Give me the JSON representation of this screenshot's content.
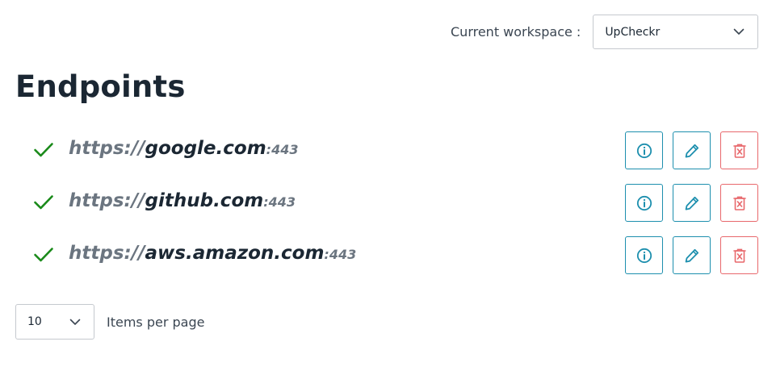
{
  "workspace": {
    "label": "Current workspace :",
    "selected": "UpCheckr",
    "icon": "chevron-down-icon"
  },
  "page": {
    "title": "Endpoints"
  },
  "endpoints": [
    {
      "protocol": "https://",
      "host": "google.com",
      "port": ":443",
      "status": "up"
    },
    {
      "protocol": "https://",
      "host": "github.com",
      "port": ":443",
      "status": "up"
    },
    {
      "protocol": "https://",
      "host": "aws.amazon.com",
      "port": ":443",
      "status": "up"
    }
  ],
  "actions": {
    "info_icon": "info-icon",
    "edit_icon": "pencil-icon",
    "delete_icon": "trash-icon"
  },
  "pagination": {
    "per_page_value": "10",
    "per_page_label": "Items per page"
  },
  "colors": {
    "status_ok": "#1a8a1a",
    "action_primary": "#1d8fae",
    "action_danger": "#e8686c",
    "text_dark": "#1b2733",
    "text_muted": "#6b7580"
  }
}
